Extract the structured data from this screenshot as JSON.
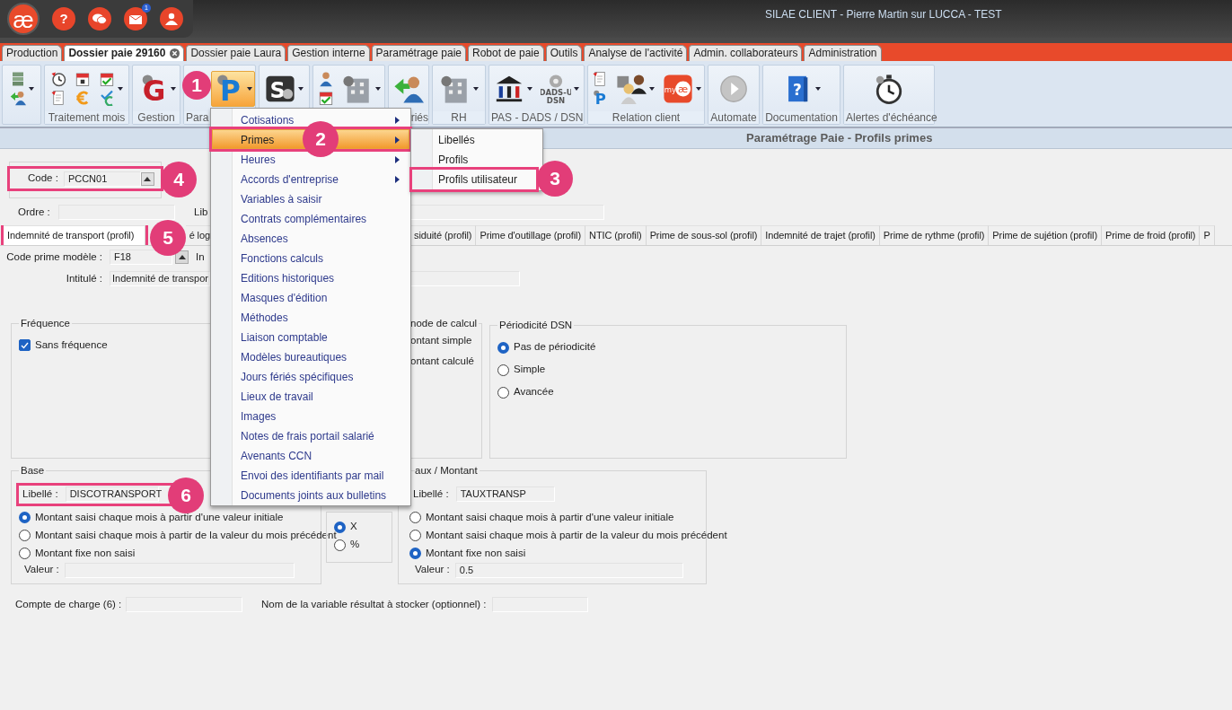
{
  "window": {
    "title": "SILAE CLIENT - Pierre Martin sur LUCCA - TEST"
  },
  "app_bar": {
    "logo": "æ",
    "buttons": [
      {
        "kind": "help",
        "glyph": "?"
      },
      {
        "kind": "chat"
      },
      {
        "kind": "mail",
        "badge": "1"
      },
      {
        "kind": "team"
      }
    ]
  },
  "tabs": [
    {
      "label": "Production",
      "selected": false,
      "closable": false
    },
    {
      "label": "Dossier paie 29160",
      "selected": true,
      "closable": true
    },
    {
      "label": "Dossier paie Laura",
      "selected": false,
      "closable": false
    },
    {
      "label": "Gestion interne",
      "selected": false,
      "closable": false
    },
    {
      "label": "Paramétrage paie",
      "selected": false,
      "closable": false
    },
    {
      "label": "Robot de paie",
      "selected": false,
      "closable": false
    },
    {
      "label": "Outils",
      "selected": false,
      "closable": false
    },
    {
      "label": "Analyse de l'activité",
      "selected": false,
      "closable": false
    },
    {
      "label": "Admin. collaborateurs",
      "selected": false,
      "closable": false
    },
    {
      "label": "Administration",
      "selected": false,
      "closable": false
    }
  ],
  "ribbon": {
    "groups": [
      {
        "columns": [
          {
            "icons": [
              {
                "kind": "server"
              },
              {
                "kind": "person-arrow"
              }
            ],
            "dropdown": true,
            "selected": false
          }
        ]
      },
      {
        "label": "Traitement mois",
        "columns": [
          {
            "icons": [
              {
                "kind": "clock"
              },
              {
                "kind": "document"
              }
            ],
            "dropdown": false,
            "selected": false
          },
          {
            "icons": [
              {
                "kind": "calendar"
              },
              {
                "kind": "euro"
              }
            ],
            "dropdown": false,
            "selected": false
          },
          {
            "icons": [
              {
                "kind": "calendar-check"
              },
              {
                "kind": "euro-check"
              }
            ],
            "dropdown": true,
            "selected": false
          }
        ]
      },
      {
        "label": "Gestion",
        "columns": [
          {
            "icons": [
              {
                "kind": "red-letter",
                "glyph": "G"
              }
            ],
            "dropdown": true,
            "selected": false
          }
        ]
      },
      {
        "label": "Para",
        "columns": [
          {
            "icons": [
              {
                "kind": "blue-letter",
                "glyph": "P"
              }
            ],
            "dropdown": true,
            "selected": true
          }
        ]
      },
      {
        "columns": [
          {
            "icons": [
              {
                "kind": "tile-letter",
                "glyph": "S"
              }
            ],
            "dropdown": true,
            "selected": false
          }
        ]
      },
      {
        "columns": [
          {
            "icons": [
              {
                "kind": "person"
              },
              {
                "kind": "calendar-check"
              }
            ],
            "dropdown": false,
            "selected": false
          },
          {
            "icons": [
              {
                "kind": "building"
              }
            ],
            "dropdown": true,
            "selected": false
          }
        ]
      },
      {
        "label": "riés",
        "columns": [
          {
            "icons": [
              {
                "kind": "person-arrow"
              }
            ],
            "dropdown": false,
            "selected": false
          }
        ]
      },
      {
        "label": "RH",
        "columns": [
          {
            "icons": [
              {
                "kind": "building"
              }
            ],
            "dropdown": true,
            "selected": false
          }
        ]
      },
      {
        "label": "PAS - DADS / DSN",
        "columns": [
          {
            "icons": [
              {
                "kind": "bank"
              }
            ],
            "dropdown": true,
            "selected": false
          },
          {
            "icons": [
              {
                "kind": "gear",
                "caption": [
                  "DADS-U",
                  "DSN"
                ]
              }
            ],
            "dropdown": true,
            "selected": false
          }
        ]
      },
      {
        "label": "Relation client",
        "columns": [
          {
            "icons": [
              {
                "kind": "document"
              },
              {
                "kind": "blue-letter",
                "glyph": "P"
              }
            ],
            "dropdown": false,
            "selected": false
          },
          {
            "icons": [
              {
                "kind": "people"
              }
            ],
            "dropdown": true,
            "selected": false
          },
          {
            "icons": [
              {
                "kind": "myae",
                "caption": [
                  "my",
                  "æ"
                ]
              }
            ],
            "dropdown": true,
            "selected": false
          }
        ]
      },
      {
        "label": "Automate",
        "columns": [
          {
            "icons": [
              {
                "kind": "play"
              }
            ],
            "dropdown": false,
            "selected": false
          }
        ]
      },
      {
        "label": "Documentation",
        "columns": [
          {
            "icons": [
              {
                "kind": "help-book",
                "glyph": "?"
              }
            ],
            "dropdown": true,
            "selected": false
          }
        ]
      },
      {
        "label": "Alertes d'échéance",
        "columns": [
          {
            "icons": [
              {
                "kind": "stopwatch"
              }
            ],
            "dropdown": false,
            "selected": false
          }
        ]
      }
    ]
  },
  "panel_title": "Paramétrage Paie - Profils primes",
  "form": {
    "code": {
      "label": "Code :",
      "value": "PCCN01",
      "highlighted": true
    },
    "ordre": {
      "label": "Ordre :"
    },
    "libelle_label": "Lib",
    "profile_tabs": [
      {
        "label": "Indemnité de transport (profil)",
        "selected": true,
        "highlighted": true
      },
      {
        "label": "é log",
        "selected": false,
        "highlighted": false
      },
      {
        "label": "siduité (profil)",
        "selected": false,
        "highlighted": false
      },
      {
        "label": "Prime d'outillage (profil)",
        "selected": false,
        "highlighted": false
      },
      {
        "label": "NTIC (profil)",
        "selected": false,
        "highlighted": false
      },
      {
        "label": "Prime de sous-sol (profil)",
        "selected": false,
        "highlighted": false
      },
      {
        "label": "Indemnité de trajet (profil)",
        "selected": false,
        "highlighted": false
      },
      {
        "label": "Prime de rythme (profil)",
        "selected": false,
        "highlighted": false
      },
      {
        "label": "Prime de sujétion (profil)",
        "selected": false,
        "highlighted": false
      },
      {
        "label": "Prime de froid (profil)",
        "selected": false,
        "highlighted": false
      },
      {
        "label": "P",
        "selected": false,
        "highlighted": false
      }
    ],
    "code_prime": {
      "label": "Code prime modèle :",
      "value": "F18"
    },
    "intitule_prefix": "In",
    "intitule": {
      "label": "Intitulé :",
      "value": "Indemnité de transpor"
    },
    "frequence": {
      "title": "Fréquence",
      "checkbox": {
        "label": "Sans fréquence",
        "checked": true
      }
    },
    "mode_calcul": {
      "title": "node de calcul",
      "options": [
        {
          "label": "ontant simple"
        },
        {
          "label": "ontant calculé"
        }
      ]
    },
    "periodicite": {
      "title": "Périodicité DSN",
      "options": [
        {
          "label": "Pas de périodicité",
          "selected": true
        },
        {
          "label": "Simple",
          "selected": false
        },
        {
          "label": "Avancée",
          "selected": false
        }
      ]
    },
    "base": {
      "title": "Base",
      "libelle": {
        "label": "Libellé :",
        "value": "DISCOTRANSPORT",
        "highlighted": true
      },
      "options": [
        {
          "label": "Montant saisi chaque mois à partir d'une valeur initiale",
          "selected": true
        },
        {
          "label": "Montant saisi chaque mois à partir de la valeur du mois précédent",
          "selected": false
        },
        {
          "label": "Montant fixe non saisi",
          "selected": false
        }
      ],
      "valeur": {
        "label": "Valeur :"
      }
    },
    "operator": {
      "options": [
        {
          "label": "X",
          "selected": true
        },
        {
          "label": "%",
          "selected": false
        }
      ]
    },
    "taux": {
      "title": "aux / Montant",
      "libelle": {
        "label": "Libellé :",
        "value": "TAUXTRANSP",
        "highlighted": false
      },
      "options": [
        {
          "label": "Montant saisi chaque mois à partir d'une valeur initiale",
          "selected": false
        },
        {
          "label": "Montant saisi chaque mois à partir de la valeur du mois précédent",
          "selected": false
        },
        {
          "label": "Montant fixe non saisi",
          "selected": true
        }
      ],
      "valeur": {
        "label": "Valeur :",
        "value": "0.5"
      }
    },
    "compte": {
      "label": "Compte de charge (6) :"
    },
    "variable": {
      "label": "Nom de la variable résultat à stocker (optionnel) :"
    }
  },
  "menu": {
    "items": [
      {
        "label": "Cotisations",
        "submenu": true,
        "selected": false,
        "highlighted": false
      },
      {
        "label": "Primes",
        "submenu": true,
        "selected": true,
        "highlighted": true
      },
      {
        "label": "Heures",
        "submenu": true,
        "selected": false,
        "highlighted": false
      },
      {
        "label": "Accords d'entreprise",
        "submenu": true,
        "selected": false,
        "highlighted": false
      },
      {
        "label": "Variables à saisir",
        "submenu": false,
        "selected": false,
        "highlighted": false
      },
      {
        "label": "Contrats complémentaires",
        "submenu": false,
        "selected": false,
        "highlighted": false
      },
      {
        "label": "Absences",
        "submenu": false,
        "selected": false,
        "highlighted": false
      },
      {
        "label": "Fonctions calculs",
        "submenu": false,
        "selected": false,
        "highlighted": false
      },
      {
        "label": "Editions historiques",
        "submenu": false,
        "selected": false,
        "highlighted": false
      },
      {
        "label": "Masques d'édition",
        "submenu": false,
        "selected": false,
        "highlighted": false
      },
      {
        "label": "Méthodes",
        "submenu": false,
        "selected": false,
        "highlighted": false
      },
      {
        "label": "Liaison comptable",
        "submenu": false,
        "selected": false,
        "highlighted": false
      },
      {
        "label": "Modèles bureautiques",
        "submenu": false,
        "selected": false,
        "highlighted": false
      },
      {
        "label": "Jours fériés spécifiques",
        "submenu": false,
        "selected": false,
        "highlighted": false
      },
      {
        "label": "Lieux de travail",
        "submenu": false,
        "selected": false,
        "highlighted": false
      },
      {
        "label": "Images",
        "submenu": false,
        "selected": false,
        "highlighted": false
      },
      {
        "label": "Notes de frais portail salarié",
        "submenu": false,
        "selected": false,
        "highlighted": false
      },
      {
        "label": "Avenants CCN",
        "submenu": false,
        "selected": false,
        "highlighted": false
      },
      {
        "label": "Envoi des identifiants par mail",
        "submenu": false,
        "selected": false,
        "highlighted": false
      },
      {
        "label": "Documents joints aux bulletins",
        "submenu": false,
        "selected": false,
        "highlighted": false
      }
    ]
  },
  "submenu": {
    "items": [
      {
        "label": "Libellés",
        "highlighted": false
      },
      {
        "label": "Profils",
        "highlighted": false
      },
      {
        "label": "Profils utilisateur",
        "highlighted": true
      }
    ]
  },
  "callouts": [
    {
      "number": "1"
    },
    {
      "number": "2"
    },
    {
      "number": "3"
    },
    {
      "number": "4"
    },
    {
      "number": "5"
    },
    {
      "number": "6"
    }
  ]
}
